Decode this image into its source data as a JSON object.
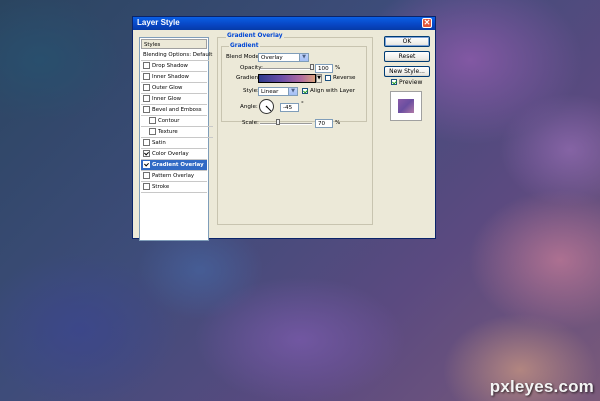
{
  "window": {
    "title": "Layer Style",
    "close_glyph": "✕"
  },
  "style_list": {
    "header": "Styles",
    "items": [
      {
        "label": "Blending Options: Default",
        "checkbox": false,
        "checked": false,
        "selected": false,
        "indent": 0
      },
      {
        "label": "Drop Shadow",
        "checkbox": true,
        "checked": false,
        "selected": false,
        "indent": 0
      },
      {
        "label": "Inner Shadow",
        "checkbox": true,
        "checked": false,
        "selected": false,
        "indent": 0
      },
      {
        "label": "Outer Glow",
        "checkbox": true,
        "checked": false,
        "selected": false,
        "indent": 0
      },
      {
        "label": "Inner Glow",
        "checkbox": true,
        "checked": false,
        "selected": false,
        "indent": 0
      },
      {
        "label": "Bevel and Emboss",
        "checkbox": true,
        "checked": false,
        "selected": false,
        "indent": 0
      },
      {
        "label": "Contour",
        "checkbox": true,
        "checked": false,
        "selected": false,
        "indent": 1
      },
      {
        "label": "Texture",
        "checkbox": true,
        "checked": false,
        "selected": false,
        "indent": 1
      },
      {
        "label": "Satin",
        "checkbox": true,
        "checked": false,
        "selected": false,
        "indent": 0
      },
      {
        "label": "Color Overlay",
        "checkbox": true,
        "checked": true,
        "selected": false,
        "indent": 0
      },
      {
        "label": "Gradient Overlay",
        "checkbox": true,
        "checked": true,
        "selected": true,
        "indent": 0
      },
      {
        "label": "Pattern Overlay",
        "checkbox": true,
        "checked": false,
        "selected": false,
        "indent": 0
      },
      {
        "label": "Stroke",
        "checkbox": true,
        "checked": false,
        "selected": false,
        "indent": 0
      }
    ]
  },
  "gradient_overlay": {
    "group_title": "Gradient Overlay",
    "inner_title": "Gradient",
    "blend_mode_label": "Blend Mode:",
    "blend_mode_value": "Overlay",
    "opacity_label": "Opacity:",
    "opacity_value": "100",
    "opacity_unit": "%",
    "opacity_fraction": 1.0,
    "gradient_label": "Gradient:",
    "reverse_label": "Reverse",
    "reverse_checked": false,
    "style_label": "Style:",
    "style_value": "Linear",
    "align_label": "Align with Layer",
    "align_checked": true,
    "angle_label": "Angle:",
    "angle_value": "-45",
    "angle_unit": "°",
    "scale_label": "Scale:",
    "scale_value": "70",
    "scale_unit": "%",
    "scale_fraction": 0.7
  },
  "buttons": {
    "ok": "OK",
    "reset": "Reset",
    "new_style": "New Style..."
  },
  "preview": {
    "label": "Preview",
    "checked": true
  },
  "watermark": "pxleyes.com"
}
